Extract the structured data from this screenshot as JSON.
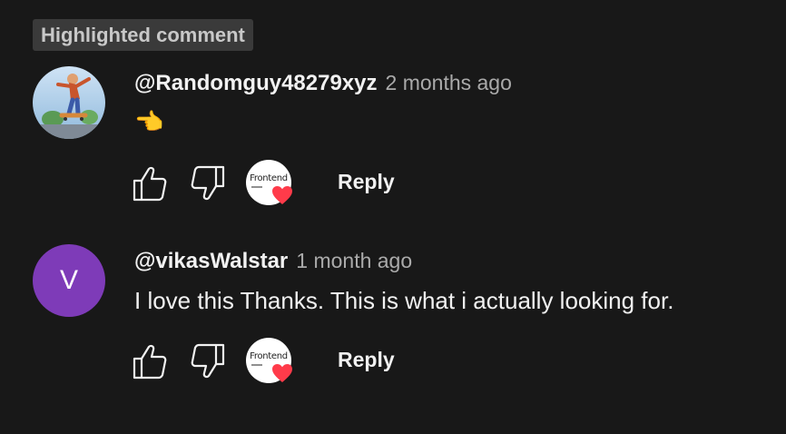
{
  "highlight_badge": "Highlighted comment",
  "comments": [
    {
      "author": "@Randomguy48279xyz",
      "time": "2 months ago",
      "text": "👈",
      "avatar_type": "image",
      "avatar_icon": "skateboarder-avatar",
      "hearted_by": "Frontend",
      "reply_label": "Reply"
    },
    {
      "author": "@vikasWalstar",
      "time": "1 month ago",
      "text": "I love this Thanks. This is what i actually looking for.",
      "avatar_type": "letter",
      "avatar_letter": "V",
      "avatar_color": "#7e3bb8",
      "hearted_by": "Frontend",
      "reply_label": "Reply"
    }
  ],
  "colors": {
    "background": "#181818",
    "badge_bg": "#3a3a3a",
    "heart": "#ff3b4a"
  }
}
